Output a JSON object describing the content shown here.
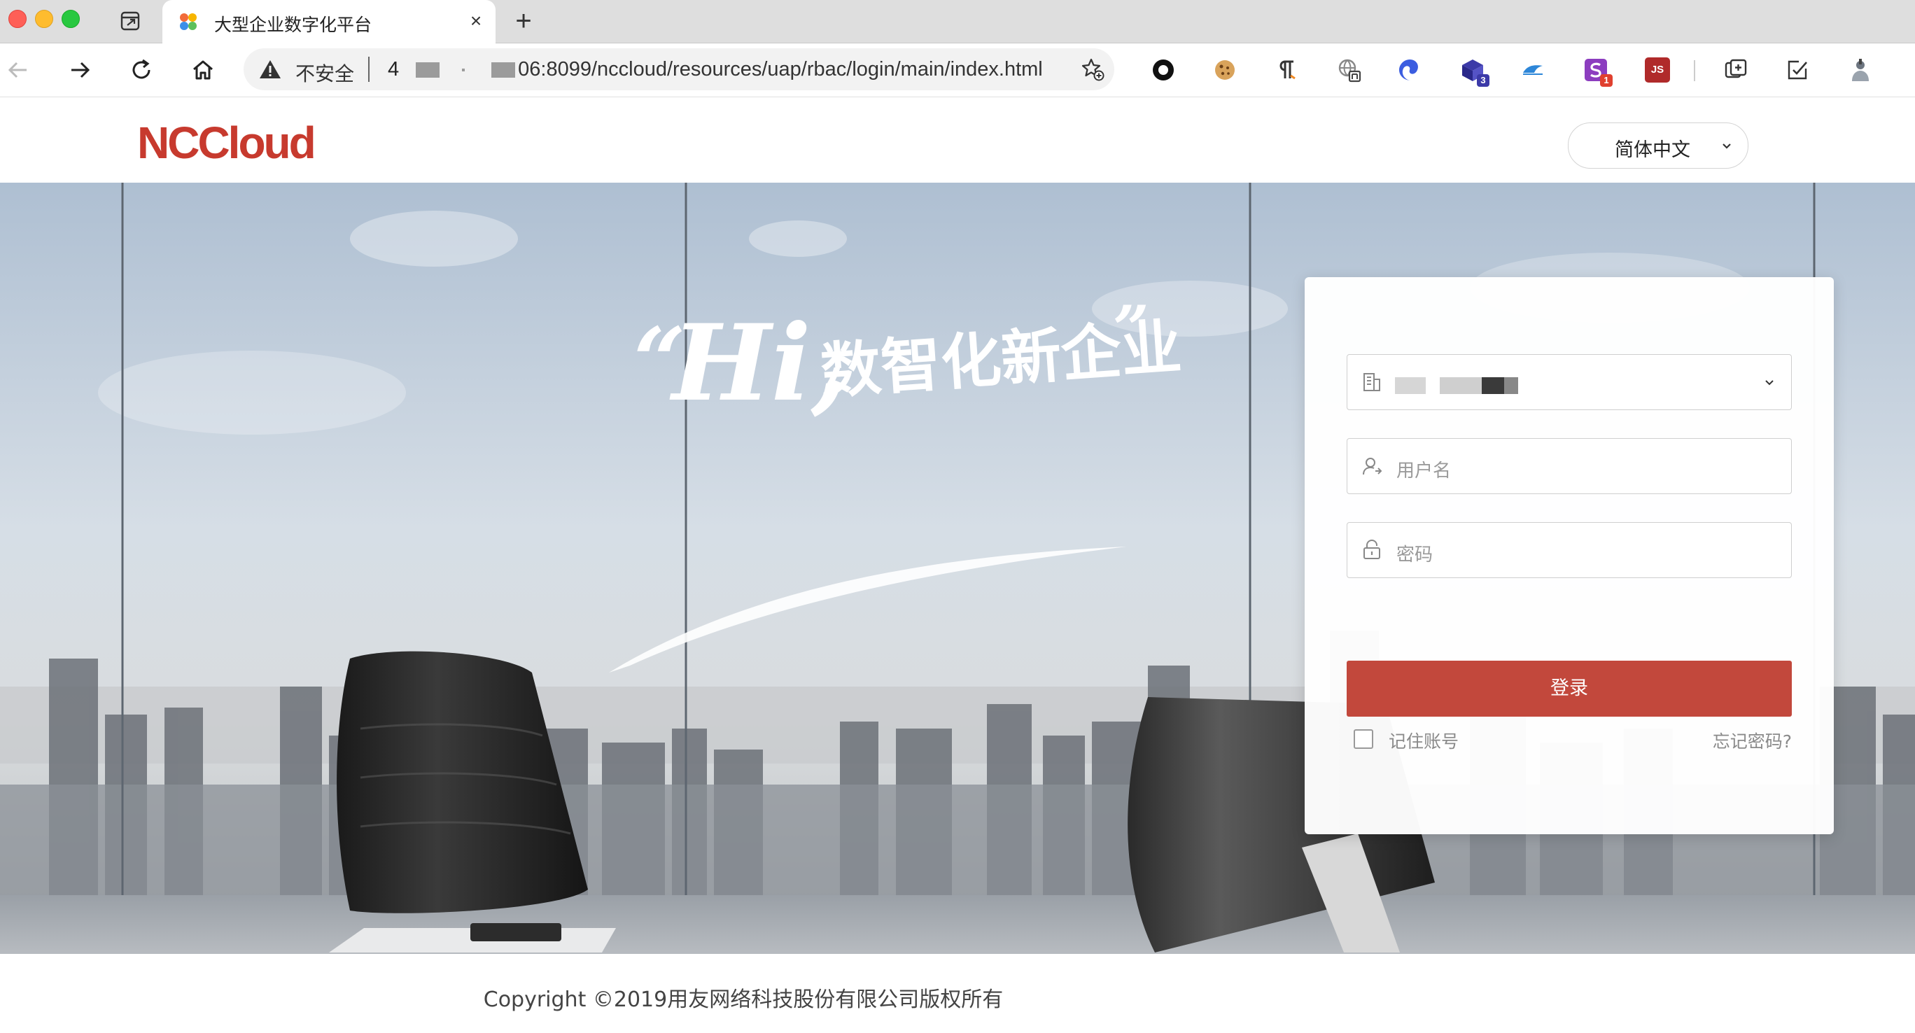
{
  "browser": {
    "tab": {
      "title": "大型企业数字化平台",
      "close_label": "×"
    },
    "new_tab_label": "+",
    "address": {
      "security_label": "不安全",
      "url_prefix": "4",
      "url_suffix": "06:8099/nccloud/resources/uap/rbac/login/main/index.html"
    },
    "extensions": [
      {
        "name": "record-icon"
      },
      {
        "name": "cookie-icon"
      },
      {
        "name": "paragraph-icon"
      },
      {
        "name": "translate-icon"
      },
      {
        "name": "swirl-icon"
      },
      {
        "name": "cube-icon",
        "badge": "3"
      },
      {
        "name": "bird-icon"
      },
      {
        "name": "s-extension-icon",
        "badge": "1"
      },
      {
        "name": "js-icon",
        "label": "JS"
      },
      {
        "name": "collections-icon"
      },
      {
        "name": "edit-check-icon"
      },
      {
        "name": "profile-icon"
      }
    ]
  },
  "page": {
    "logo_text": "NCCloud",
    "language_select": {
      "value": "简体中文"
    },
    "hero": {
      "slogan_hi": "Hi,",
      "slogan_text": "数智化新企业"
    },
    "login": {
      "org_select": {
        "value_redacted": true
      },
      "username": {
        "placeholder": "用户名"
      },
      "password": {
        "placeholder": "密码"
      },
      "submit_label": "登录",
      "remember_label": "记住账号",
      "forgot_label": "忘记密码?"
    },
    "footer": {
      "copyright": "Copyright ©2019用友网络科技股份有限公司版权所有"
    }
  },
  "colors": {
    "brand_red": "#c73a2e",
    "login_button": "#c2483c",
    "url_bar": "#f2f2f2"
  }
}
